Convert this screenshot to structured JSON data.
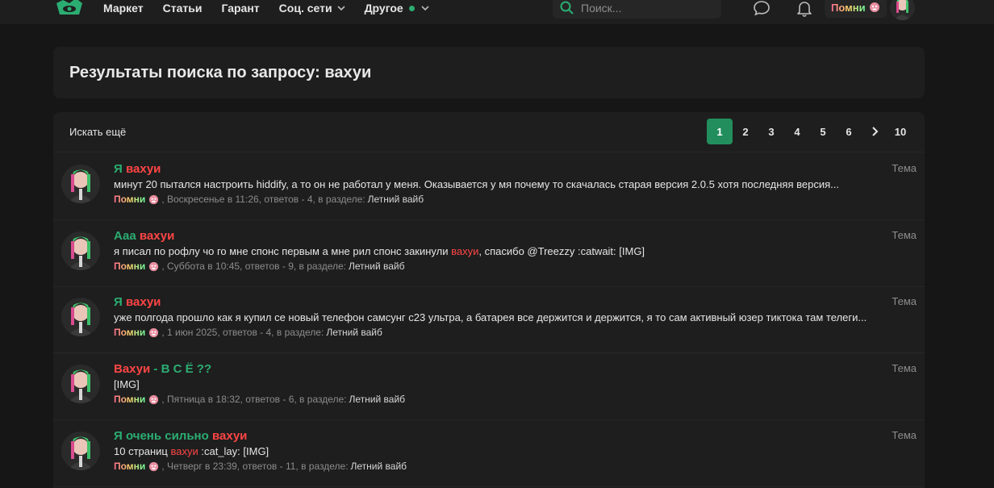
{
  "nav": {
    "items": [
      "Маркет",
      "Статьи",
      "Гарант",
      "Соц. сети",
      "Другое"
    ]
  },
  "search": {
    "placeholder": "Поиск..."
  },
  "user": {
    "name": "Помни"
  },
  "page_title": "Результаты поиска по запросу: вахуи",
  "results_header": {
    "search_more": "Искать ещё",
    "pages": [
      "1",
      "2",
      "3",
      "4",
      "5",
      "6",
      "10"
    ],
    "current_page": "1"
  },
  "results": [
    {
      "title_prefix": "Я ",
      "title_highlight": "вахуи",
      "title_suffix": "",
      "snippet_pre": "минут 20 пытался настроить hiddify, а то он не работал у меня. Оказывается у мя почему то скачалась старая версия 2.0.5 хотя последняя версия...",
      "snippet_hl": "",
      "snippet_post": "",
      "author": "Помни",
      "meta": ", Воскресенье в 11:26, ответов - 4, в разделе:",
      "section": "Летний вайб",
      "type": "Тема"
    },
    {
      "title_prefix": "Ааа ",
      "title_highlight": "вахуи",
      "title_suffix": "",
      "snippet_pre": "я писал по рофлу чо го мне спонс первым а мне рил спонс закинули ",
      "snippet_hl": "вахуи",
      "snippet_post": ", спасибо @Treezzy :catwait: [IMG]",
      "author": "Помни",
      "meta": ", Суббота в 10:45, ответов - 9, в разделе:",
      "section": "Летний вайб",
      "type": "Тема"
    },
    {
      "title_prefix": "Я ",
      "title_highlight": "вахуи",
      "title_suffix": "",
      "snippet_pre": "уже полгода прошло как я купил се новый телефон самсунг с23 ультра, а батарея все держится и держится, я то сам активный юзер тиктока там телеги...",
      "snippet_hl": "",
      "snippet_post": "",
      "author": "Помни",
      "meta": ", 1 июн 2025, ответов - 4, в разделе:",
      "section": "Летний вайб",
      "type": "Тема"
    },
    {
      "title_prefix": "",
      "title_highlight": "Вахуи",
      "title_suffix": " - В С Ё ??",
      "snippet_pre": "[IMG]",
      "snippet_hl": "",
      "snippet_post": "",
      "author": "Помни",
      "meta": ", Пятница в 18:32, ответов - 6, в разделе:",
      "section": "Летний вайб",
      "type": "Тема"
    },
    {
      "title_prefix": "Я очень сильно ",
      "title_highlight": "вахуи",
      "title_suffix": "",
      "snippet_pre": "10 страниц ",
      "snippet_hl": "вахуи",
      "snippet_post": " :cat_lay: [IMG]",
      "author": "Помни",
      "meta": ", Четверг в 23:39, ответов - 11, в разделе:",
      "section": "Летний вайб",
      "type": "Тема"
    }
  ],
  "colors": {
    "accent": "#228e5d",
    "green": "#2bad72",
    "highlight": "#ff4545",
    "bg": "#161616",
    "block": "#1e1e1e"
  },
  "icons": [
    "logo-icon",
    "chevron-down-icon",
    "search-icon",
    "chat-icon",
    "bell-icon",
    "chevron-right-icon",
    "badge-icon",
    "avatar"
  ]
}
